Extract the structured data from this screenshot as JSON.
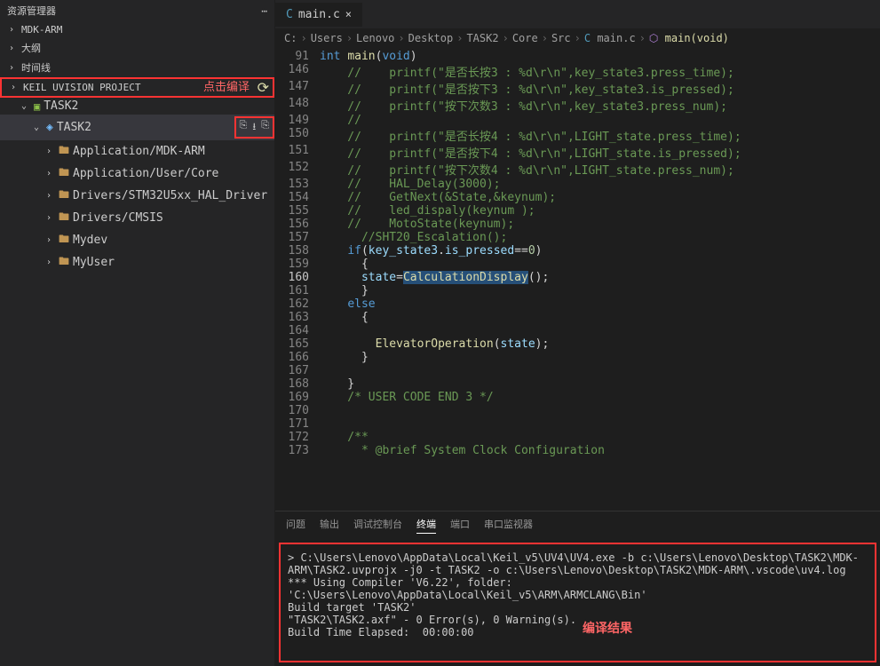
{
  "sidebar": {
    "title": "资源管理器",
    "sections": [
      "MDK-ARM",
      "大纲",
      "时间线",
      "KEIL UVISION PROJECT"
    ],
    "clickLabel": "点击编译",
    "project": "TASK2",
    "target": "TASK2",
    "folders": [
      "Application/MDK-ARM",
      "Application/User/Core",
      "Drivers/STM32U5xx_HAL_Driver",
      "Drivers/CMSIS",
      "Mydev",
      "MyUser"
    ]
  },
  "tab": {
    "name": "main.c"
  },
  "breadcrumb": [
    "C:",
    "Users",
    "Lenovo",
    "Desktop",
    "TASK2",
    "Core",
    "Src",
    "main.c",
    "main(void)"
  ],
  "code": {
    "start": 91,
    "sigLine": "int main(void)",
    "lines": [
      {
        "n": 146,
        "t": "//    printf(\"是否长按3 : %d\\r\\n\",key_state3.press_time);",
        "c": "cmt"
      },
      {
        "n": 147,
        "t": "//    printf(\"是否按下3 : %d\\r\\n\",key_state3.is_pressed);",
        "c": "cmt"
      },
      {
        "n": 148,
        "t": "//    printf(\"按下次数3 : %d\\r\\n\",key_state3.press_num);",
        "c": "cmt"
      },
      {
        "n": 149,
        "t": "//",
        "c": "cmt"
      },
      {
        "n": 150,
        "t": "//    printf(\"是否长按4 : %d\\r\\n\",LIGHT_state.press_time);",
        "c": "cmt"
      },
      {
        "n": 151,
        "t": "//    printf(\"是否按下4 : %d\\r\\n\",LIGHT_state.is_pressed);",
        "c": "cmt"
      },
      {
        "n": 152,
        "t": "//    printf(\"按下次数4 : %d\\r\\n\",LIGHT_state.press_num);",
        "c": "cmt"
      },
      {
        "n": 153,
        "t": "//    HAL_Delay(3000);",
        "c": "cmt"
      },
      {
        "n": 154,
        "t": "//    GetNext(&State,&keynum);",
        "c": "cmt"
      },
      {
        "n": 155,
        "t": "//    led_dispaly(keynum );",
        "c": "cmt"
      },
      {
        "n": 156,
        "t": "//    MotoState(keynum);",
        "c": "cmt"
      },
      {
        "n": 157,
        "t": "  //SHT20_Escalation();",
        "c": "cmt"
      },
      {
        "n": 158,
        "t": "  if(key_state3.is_pressed==0)",
        "c": "code"
      },
      {
        "n": 159,
        "t": "  {",
        "c": "pun"
      },
      {
        "n": 160,
        "t": "    state=CalculationDisplay();",
        "c": "hl"
      },
      {
        "n": 161,
        "t": "  }",
        "c": "pun"
      },
      {
        "n": 162,
        "t": "  else",
        "c": "kw"
      },
      {
        "n": 163,
        "t": "  {",
        "c": "pun"
      },
      {
        "n": 164,
        "t": "",
        "c": "pun"
      },
      {
        "n": 165,
        "t": "    ElevatorOperation(state);",
        "c": "code2"
      },
      {
        "n": 166,
        "t": "  }",
        "c": "pun"
      },
      {
        "n": 167,
        "t": "",
        "c": "pun"
      },
      {
        "n": 168,
        "t": "}",
        "c": "pun"
      },
      {
        "n": 169,
        "t": "/* USER CODE END 3 */",
        "c": "cmt"
      },
      {
        "n": 170,
        "t": "",
        "c": "pun"
      },
      {
        "n": 171,
        "t": "",
        "c": "pun"
      },
      {
        "n": 172,
        "t": "/**",
        "c": "cmt"
      },
      {
        "n": 173,
        "t": "  * @brief System Clock Configuration",
        "c": "cmt"
      }
    ]
  },
  "panel": {
    "tabs": [
      "问题",
      "输出",
      "调试控制台",
      "终端",
      "端口",
      "串口监视器"
    ],
    "active": 3,
    "resultLabel": "编译结果",
    "lines": [
      "> C:\\Users\\Lenovo\\AppData\\Local\\Keil_v5\\UV4\\UV4.exe -b c:\\Users\\Lenovo\\Desktop\\TASK2\\MDK-ARM\\TASK2.uvprojx -j0 -t TASK2 -o c:\\Users\\Lenovo\\Desktop\\TASK2\\MDK-ARM\\.vscode\\uv4.log",
      "",
      "*** Using Compiler 'V6.22', folder: 'C:\\Users\\Lenovo\\AppData\\Local\\Keil_v5\\ARM\\ARMCLANG\\Bin'",
      "Build target 'TASK2'",
      "\"TASK2\\TASK2.axf\" - 0 Error(s), 0 Warning(s).",
      "Build Time Elapsed:  00:00:00"
    ]
  }
}
